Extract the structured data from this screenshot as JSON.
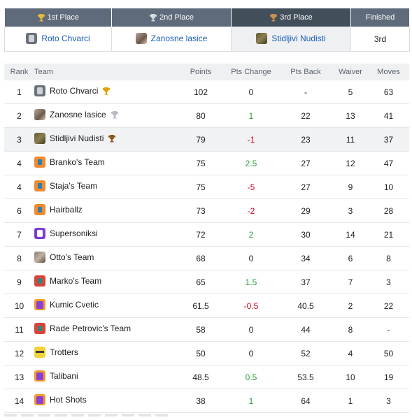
{
  "places": {
    "headers": [
      {
        "label": "1st Place",
        "icon": "gold-trophy-icon"
      },
      {
        "label": "2nd Place",
        "icon": "silver-trophy-icon"
      },
      {
        "label": "3rd Place",
        "icon": "bronze-trophy-icon"
      },
      {
        "label": "Finished"
      }
    ],
    "teams": [
      "Roto Chvarci",
      "Zanosne lasice",
      "Stidljivi Nudisti"
    ],
    "finished": "3rd"
  },
  "standings": {
    "columns": [
      "Rank",
      "Team",
      "Points",
      "Pts Change",
      "Pts Back",
      "Waiver",
      "Moves"
    ],
    "rows": [
      {
        "rank": "1",
        "team": "Roto Chvarci",
        "trophy": "gold-trophy-icon",
        "points": "102",
        "change": "0",
        "back": "-",
        "waiver": "5",
        "moves": "63"
      },
      {
        "rank": "2",
        "team": "Zanosne lasice",
        "trophy": "silver-trophy-icon",
        "points": "80",
        "change": "1",
        "back": "22",
        "waiver": "13",
        "moves": "41"
      },
      {
        "rank": "3",
        "team": "Stidljivi Nudisti",
        "trophy": "bronze-trophy-icon",
        "points": "79",
        "change": "-1",
        "back": "23",
        "waiver": "11",
        "moves": "37"
      },
      {
        "rank": "4",
        "team": "Branko's Team",
        "points": "75",
        "change": "2.5",
        "back": "27",
        "waiver": "12",
        "moves": "47"
      },
      {
        "rank": "4",
        "team": "Staja's Team",
        "points": "75",
        "change": "-5",
        "back": "27",
        "waiver": "9",
        "moves": "10"
      },
      {
        "rank": "6",
        "team": "Hairballz",
        "points": "73",
        "change": "-2",
        "back": "29",
        "waiver": "3",
        "moves": "28"
      },
      {
        "rank": "7",
        "team": "Supersoniksi",
        "points": "72",
        "change": "2",
        "back": "30",
        "waiver": "14",
        "moves": "21"
      },
      {
        "rank": "8",
        "team": "Otto's Team",
        "points": "68",
        "change": "0",
        "back": "34",
        "waiver": "6",
        "moves": "8"
      },
      {
        "rank": "9",
        "team": "Marko's Team",
        "points": "65",
        "change": "1.5",
        "back": "37",
        "waiver": "7",
        "moves": "3"
      },
      {
        "rank": "10",
        "team": "Kumic Cvetic",
        "points": "61.5",
        "change": "-0.5",
        "back": "40.5",
        "waiver": "2",
        "moves": "22"
      },
      {
        "rank": "11",
        "team": "Rade Petrovic's Team",
        "points": "58",
        "change": "0",
        "back": "44",
        "waiver": "8",
        "moves": "-"
      },
      {
        "rank": "12",
        "team": "Trotters",
        "points": "50",
        "change": "0",
        "back": "52",
        "waiver": "4",
        "moves": "50"
      },
      {
        "rank": "13",
        "team": "Talibani",
        "points": "48.5",
        "change": "0.5",
        "back": "53.5",
        "waiver": "10",
        "moves": "19"
      },
      {
        "rank": "14",
        "team": "Hot Shots",
        "points": "38",
        "change": "1",
        "back": "64",
        "waiver": "1",
        "moves": "3"
      }
    ]
  },
  "colors": {
    "header_bg": "#5f6b7a",
    "link": "#1a5fb4",
    "positive": "#2a9d3a",
    "negative": "#d0021b",
    "gold": "#e0a100",
    "silver": "#b8bcc2",
    "bronze": "#8a5a1e"
  }
}
